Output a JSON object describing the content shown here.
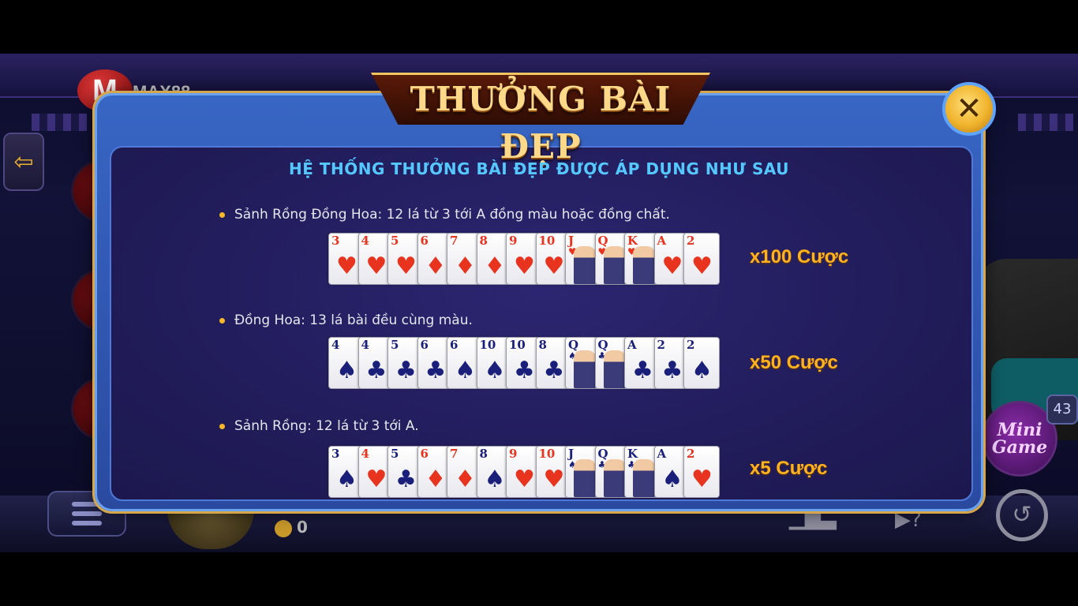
{
  "background": {
    "logo_letter": "M",
    "logo_text": "MAX88",
    "coins": "0",
    "mini_game_label_1": "Mini",
    "mini_game_label_2": "Game",
    "mini_game_badge": "43"
  },
  "modal": {
    "title": "THƯỞNG BÀI ĐẸP",
    "subtitle": "HỆ THỐNG THƯỞNG BÀI ĐẸP ĐƯỢC ÁP DỤNG NHƯ SAU",
    "close_label": "✕",
    "rules": [
      {
        "text": "Sảnh Rồng Đồng Hoa: 12 lá từ 3 tới A đồng màu hoặc đồng chất.",
        "payout": "x100 Cược",
        "cards": [
          {
            "rank": "3",
            "suit": "♥",
            "color": "red"
          },
          {
            "rank": "4",
            "suit": "♥",
            "color": "red"
          },
          {
            "rank": "5",
            "suit": "♥",
            "color": "red"
          },
          {
            "rank": "6",
            "suit": "♦",
            "color": "red"
          },
          {
            "rank": "7",
            "suit": "♦",
            "color": "red"
          },
          {
            "rank": "8",
            "suit": "♦",
            "color": "red"
          },
          {
            "rank": "9",
            "suit": "♥",
            "color": "red"
          },
          {
            "rank": "10",
            "suit": "♥",
            "color": "red"
          },
          {
            "rank": "J",
            "suit": "♥",
            "color": "red",
            "face": true
          },
          {
            "rank": "Q",
            "suit": "♥",
            "color": "red",
            "face": true
          },
          {
            "rank": "K",
            "suit": "♥",
            "color": "red",
            "face": true
          },
          {
            "rank": "A",
            "suit": "♥",
            "color": "red"
          },
          {
            "rank": "2",
            "suit": "♥",
            "color": "red"
          }
        ]
      },
      {
        "text": "Đồng Hoa: 13 lá bài đều cùng màu.",
        "payout": "x50 Cược",
        "cards": [
          {
            "rank": "4",
            "suit": "♠",
            "color": "blk"
          },
          {
            "rank": "4",
            "suit": "♣",
            "color": "blk"
          },
          {
            "rank": "5",
            "suit": "♣",
            "color": "blk"
          },
          {
            "rank": "6",
            "suit": "♣",
            "color": "blk"
          },
          {
            "rank": "6",
            "suit": "♠",
            "color": "blk"
          },
          {
            "rank": "10",
            "suit": "♠",
            "color": "blk"
          },
          {
            "rank": "10",
            "suit": "♣",
            "color": "blk"
          },
          {
            "rank": "8",
            "suit": "♣",
            "color": "blk"
          },
          {
            "rank": "Q",
            "suit": "♠",
            "color": "blk",
            "face": true
          },
          {
            "rank": "Q",
            "suit": "♣",
            "color": "blk",
            "face": true
          },
          {
            "rank": "A",
            "suit": "♣",
            "color": "blk"
          },
          {
            "rank": "2",
            "suit": "♣",
            "color": "blk"
          },
          {
            "rank": "2",
            "suit": "♠",
            "color": "blk"
          }
        ]
      },
      {
        "text": "Sảnh Rồng: 12 lá từ 3 tới A.",
        "payout": "x5 Cược",
        "cards": [
          {
            "rank": "3",
            "suit": "♠",
            "color": "blk"
          },
          {
            "rank": "4",
            "suit": "♥",
            "color": "red"
          },
          {
            "rank": "5",
            "suit": "♣",
            "color": "blk"
          },
          {
            "rank": "6",
            "suit": "♦",
            "color": "red"
          },
          {
            "rank": "7",
            "suit": "♦",
            "color": "red"
          },
          {
            "rank": "8",
            "suit": "♠",
            "color": "blk"
          },
          {
            "rank": "9",
            "suit": "♥",
            "color": "red"
          },
          {
            "rank": "10",
            "suit": "♥",
            "color": "red"
          },
          {
            "rank": "J",
            "suit": "♠",
            "color": "blk",
            "face": true
          },
          {
            "rank": "Q",
            "suit": "♣",
            "color": "blk",
            "face": true
          },
          {
            "rank": "K",
            "suit": "♣",
            "color": "blk",
            "face": true
          },
          {
            "rank": "A",
            "suit": "♠",
            "color": "blk"
          },
          {
            "rank": "2",
            "suit": "♥",
            "color": "red"
          }
        ]
      }
    ]
  },
  "colors": {
    "accent_gold": "#ffb21e",
    "subtitle_blue": "#54c8ff",
    "modal_blue": "#3866c4"
  }
}
